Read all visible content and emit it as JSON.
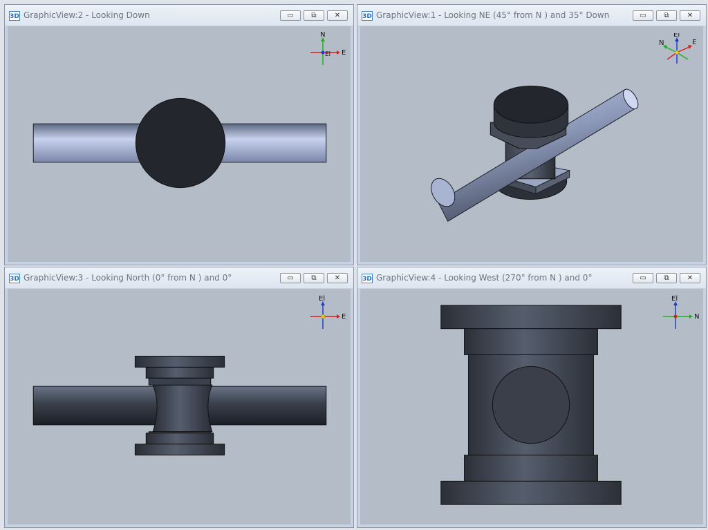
{
  "panes": {
    "top_left": {
      "badge": "3D",
      "title": "GraphicView:2 - Looking Down"
    },
    "top_right": {
      "badge": "3D",
      "title": "GraphicView:1 - Looking NE (45° from N ) and 35° Down"
    },
    "bot_left": {
      "badge": "3D",
      "title": "GraphicView:3 - Looking North (0° from N ) and 0°"
    },
    "bot_right": {
      "badge": "3D",
      "title": "GraphicView:4 - Looking West (270° from N ) and 0°"
    }
  },
  "window_buttons": {
    "minimize": "▭",
    "restore": "⧉",
    "close": "✕"
  },
  "axes": {
    "top_left": {
      "up": "N",
      "right": "E",
      "center": "El"
    },
    "top_right": {
      "up": "El",
      "left": "N",
      "right": "E"
    },
    "bot_left": {
      "up": "El",
      "right": "E"
    },
    "bot_right": {
      "up": "El",
      "right": "N"
    }
  },
  "colors": {
    "axis_x": "#d92020",
    "axis_y": "#20b020",
    "axis_z": "#1a3fd0",
    "model_dark": "#2a2e36"
  }
}
